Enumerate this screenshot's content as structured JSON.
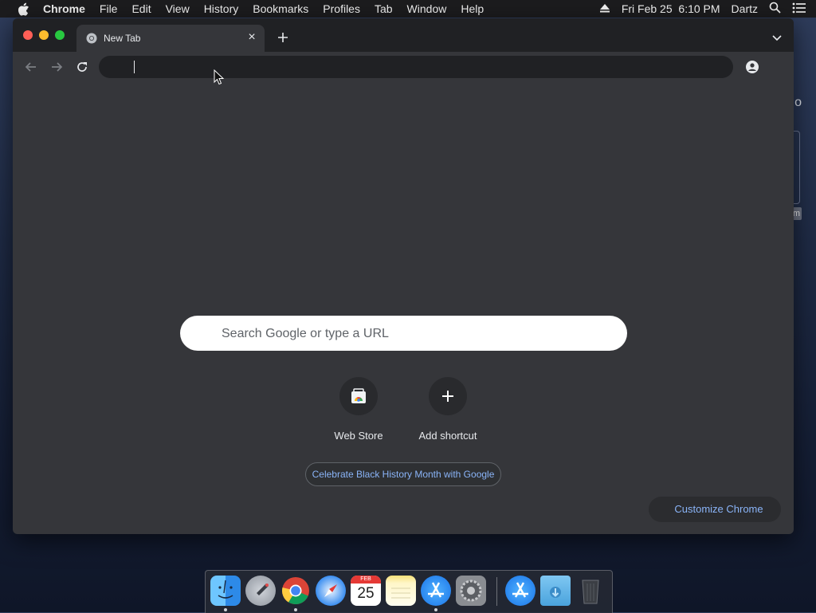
{
  "menubar": {
    "app_name": "Chrome",
    "items": [
      "File",
      "Edit",
      "View",
      "History",
      "Bookmarks",
      "Profiles",
      "Tab",
      "Window",
      "Help"
    ],
    "datetime": "Fri Feb 25  6:10 PM",
    "user": "Dartz"
  },
  "browser": {
    "tab_title": "New Tab",
    "omnibox_value": ""
  },
  "ntp": {
    "search_placeholder": "Search Google or type a URL",
    "shortcuts": [
      {
        "label": "Web Store",
        "icon": "web-store-icon"
      },
      {
        "label": "Add shortcut",
        "icon": "plus-icon"
      }
    ],
    "promo": "Celebrate Black History Month with Google",
    "customize": "Customize Chrome"
  },
  "desktop": {
    "peek_text": "o",
    "peek_chip": "m"
  },
  "dock": {
    "apps": [
      "Finder",
      "Launchpad",
      "Google Chrome",
      "Safari",
      "Calendar",
      "Notes",
      "App Store",
      "System Preferences",
      "App Store",
      "Downloads",
      "Trash"
    ],
    "calendar_month": "FEB",
    "calendar_day": "25"
  },
  "colors": {
    "window_bg": "#35363a",
    "tabstrip_bg": "#202124",
    "link_blue": "#8ab4f8",
    "close_red": "#ff5f57",
    "min_yellow": "#febc2e",
    "max_green": "#28c840"
  }
}
